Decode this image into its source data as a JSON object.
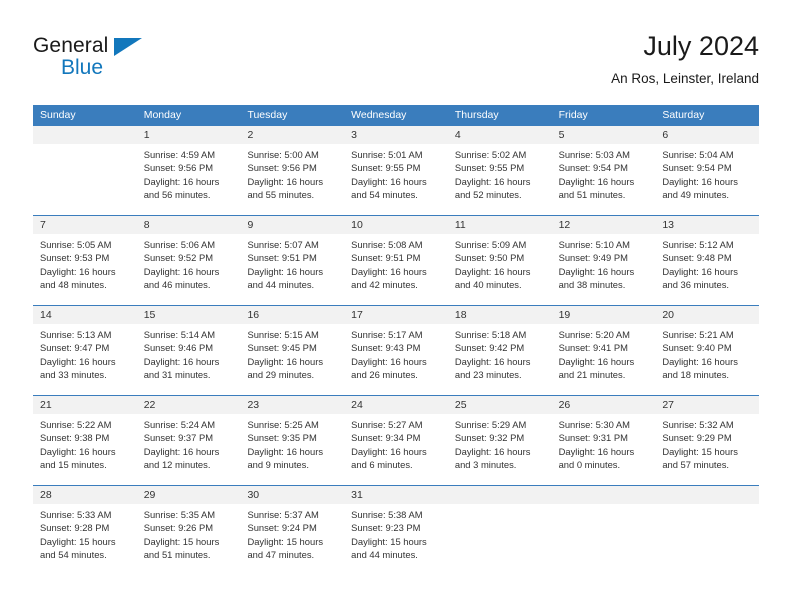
{
  "brand": {
    "word1": "General",
    "word2": "Blue",
    "logo_icon": "triangle-flag-icon"
  },
  "header": {
    "title": "July 2024",
    "location": "An Ros, Leinster, Ireland"
  },
  "calendar": {
    "weekday_headers": [
      "Sunday",
      "Monday",
      "Tuesday",
      "Wednesday",
      "Thursday",
      "Friday",
      "Saturday"
    ],
    "accent_color": "#3a7dbd",
    "daynum_band_color": "#f2f2f2",
    "weeks": [
      [
        {
          "day": "",
          "lines": []
        },
        {
          "day": "1",
          "lines": [
            "Sunrise: 4:59 AM",
            "Sunset: 9:56 PM",
            "Daylight: 16 hours",
            "and 56 minutes."
          ]
        },
        {
          "day": "2",
          "lines": [
            "Sunrise: 5:00 AM",
            "Sunset: 9:56 PM",
            "Daylight: 16 hours",
            "and 55 minutes."
          ]
        },
        {
          "day": "3",
          "lines": [
            "Sunrise: 5:01 AM",
            "Sunset: 9:55 PM",
            "Daylight: 16 hours",
            "and 54 minutes."
          ]
        },
        {
          "day": "4",
          "lines": [
            "Sunrise: 5:02 AM",
            "Sunset: 9:55 PM",
            "Daylight: 16 hours",
            "and 52 minutes."
          ]
        },
        {
          "day": "5",
          "lines": [
            "Sunrise: 5:03 AM",
            "Sunset: 9:54 PM",
            "Daylight: 16 hours",
            "and 51 minutes."
          ]
        },
        {
          "day": "6",
          "lines": [
            "Sunrise: 5:04 AM",
            "Sunset: 9:54 PM",
            "Daylight: 16 hours",
            "and 49 minutes."
          ]
        }
      ],
      [
        {
          "day": "7",
          "lines": [
            "Sunrise: 5:05 AM",
            "Sunset: 9:53 PM",
            "Daylight: 16 hours",
            "and 48 minutes."
          ]
        },
        {
          "day": "8",
          "lines": [
            "Sunrise: 5:06 AM",
            "Sunset: 9:52 PM",
            "Daylight: 16 hours",
            "and 46 minutes."
          ]
        },
        {
          "day": "9",
          "lines": [
            "Sunrise: 5:07 AM",
            "Sunset: 9:51 PM",
            "Daylight: 16 hours",
            "and 44 minutes."
          ]
        },
        {
          "day": "10",
          "lines": [
            "Sunrise: 5:08 AM",
            "Sunset: 9:51 PM",
            "Daylight: 16 hours",
            "and 42 minutes."
          ]
        },
        {
          "day": "11",
          "lines": [
            "Sunrise: 5:09 AM",
            "Sunset: 9:50 PM",
            "Daylight: 16 hours",
            "and 40 minutes."
          ]
        },
        {
          "day": "12",
          "lines": [
            "Sunrise: 5:10 AM",
            "Sunset: 9:49 PM",
            "Daylight: 16 hours",
            "and 38 minutes."
          ]
        },
        {
          "day": "13",
          "lines": [
            "Sunrise: 5:12 AM",
            "Sunset: 9:48 PM",
            "Daylight: 16 hours",
            "and 36 minutes."
          ]
        }
      ],
      [
        {
          "day": "14",
          "lines": [
            "Sunrise: 5:13 AM",
            "Sunset: 9:47 PM",
            "Daylight: 16 hours",
            "and 33 minutes."
          ]
        },
        {
          "day": "15",
          "lines": [
            "Sunrise: 5:14 AM",
            "Sunset: 9:46 PM",
            "Daylight: 16 hours",
            "and 31 minutes."
          ]
        },
        {
          "day": "16",
          "lines": [
            "Sunrise: 5:15 AM",
            "Sunset: 9:45 PM",
            "Daylight: 16 hours",
            "and 29 minutes."
          ]
        },
        {
          "day": "17",
          "lines": [
            "Sunrise: 5:17 AM",
            "Sunset: 9:43 PM",
            "Daylight: 16 hours",
            "and 26 minutes."
          ]
        },
        {
          "day": "18",
          "lines": [
            "Sunrise: 5:18 AM",
            "Sunset: 9:42 PM",
            "Daylight: 16 hours",
            "and 23 minutes."
          ]
        },
        {
          "day": "19",
          "lines": [
            "Sunrise: 5:20 AM",
            "Sunset: 9:41 PM",
            "Daylight: 16 hours",
            "and 21 minutes."
          ]
        },
        {
          "day": "20",
          "lines": [
            "Sunrise: 5:21 AM",
            "Sunset: 9:40 PM",
            "Daylight: 16 hours",
            "and 18 minutes."
          ]
        }
      ],
      [
        {
          "day": "21",
          "lines": [
            "Sunrise: 5:22 AM",
            "Sunset: 9:38 PM",
            "Daylight: 16 hours",
            "and 15 minutes."
          ]
        },
        {
          "day": "22",
          "lines": [
            "Sunrise: 5:24 AM",
            "Sunset: 9:37 PM",
            "Daylight: 16 hours",
            "and 12 minutes."
          ]
        },
        {
          "day": "23",
          "lines": [
            "Sunrise: 5:25 AM",
            "Sunset: 9:35 PM",
            "Daylight: 16 hours",
            "and 9 minutes."
          ]
        },
        {
          "day": "24",
          "lines": [
            "Sunrise: 5:27 AM",
            "Sunset: 9:34 PM",
            "Daylight: 16 hours",
            "and 6 minutes."
          ]
        },
        {
          "day": "25",
          "lines": [
            "Sunrise: 5:29 AM",
            "Sunset: 9:32 PM",
            "Daylight: 16 hours",
            "and 3 minutes."
          ]
        },
        {
          "day": "26",
          "lines": [
            "Sunrise: 5:30 AM",
            "Sunset: 9:31 PM",
            "Daylight: 16 hours",
            "and 0 minutes."
          ]
        },
        {
          "day": "27",
          "lines": [
            "Sunrise: 5:32 AM",
            "Sunset: 9:29 PM",
            "Daylight: 15 hours",
            "and 57 minutes."
          ]
        }
      ],
      [
        {
          "day": "28",
          "lines": [
            "Sunrise: 5:33 AM",
            "Sunset: 9:28 PM",
            "Daylight: 15 hours",
            "and 54 minutes."
          ]
        },
        {
          "day": "29",
          "lines": [
            "Sunrise: 5:35 AM",
            "Sunset: 9:26 PM",
            "Daylight: 15 hours",
            "and 51 minutes."
          ]
        },
        {
          "day": "30",
          "lines": [
            "Sunrise: 5:37 AM",
            "Sunset: 9:24 PM",
            "Daylight: 15 hours",
            "and 47 minutes."
          ]
        },
        {
          "day": "31",
          "lines": [
            "Sunrise: 5:38 AM",
            "Sunset: 9:23 PM",
            "Daylight: 15 hours",
            "and 44 minutes."
          ]
        },
        {
          "day": "",
          "lines": []
        },
        {
          "day": "",
          "lines": []
        },
        {
          "day": "",
          "lines": []
        }
      ]
    ]
  }
}
